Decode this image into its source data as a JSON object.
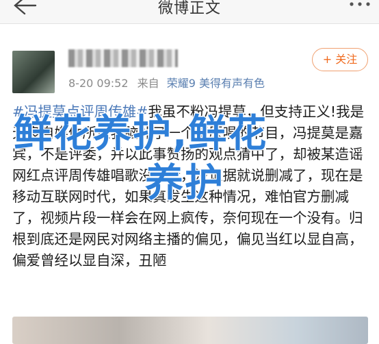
{
  "topbar": {
    "title": "微博正文",
    "back_icon": "back-arrow-icon",
    "more_icon": "more-dots-icon"
  },
  "post": {
    "meta_time": "8-20 09:52",
    "meta_source_prefix": "来自",
    "meta_device": "荣耀9 美得有声有色",
    "follow_label": "+ 关注",
    "hashtag": "#冯提莫点评周传雄#",
    "body": "我虽不粉冯提莫，但支持正义!我是无良自媒体所以我脑补了一个猜原唱的节目，冯提莫是嘉宾，不是评委，并以此事赞扬的观点猜中了，却被某造谣网红点评周传雄唱歌没感情，没证据就说删减了，现在是移动互联网时代，如果真发生这种情况，难怕官方删减了，视频片段一样会在网上疯传，奈何现在一个没有。归根到底还是网民对网络主播的偏见，偏见当红以显自高，偏爱曾经以显自深，丑陋"
  },
  "watermark": {
    "line1": "鲜花养护,鲜花",
    "line2": "养护"
  },
  "colors": {
    "link": "#4a78b8",
    "follow": "#f06a1e",
    "watermark": "#2e7fd8"
  }
}
